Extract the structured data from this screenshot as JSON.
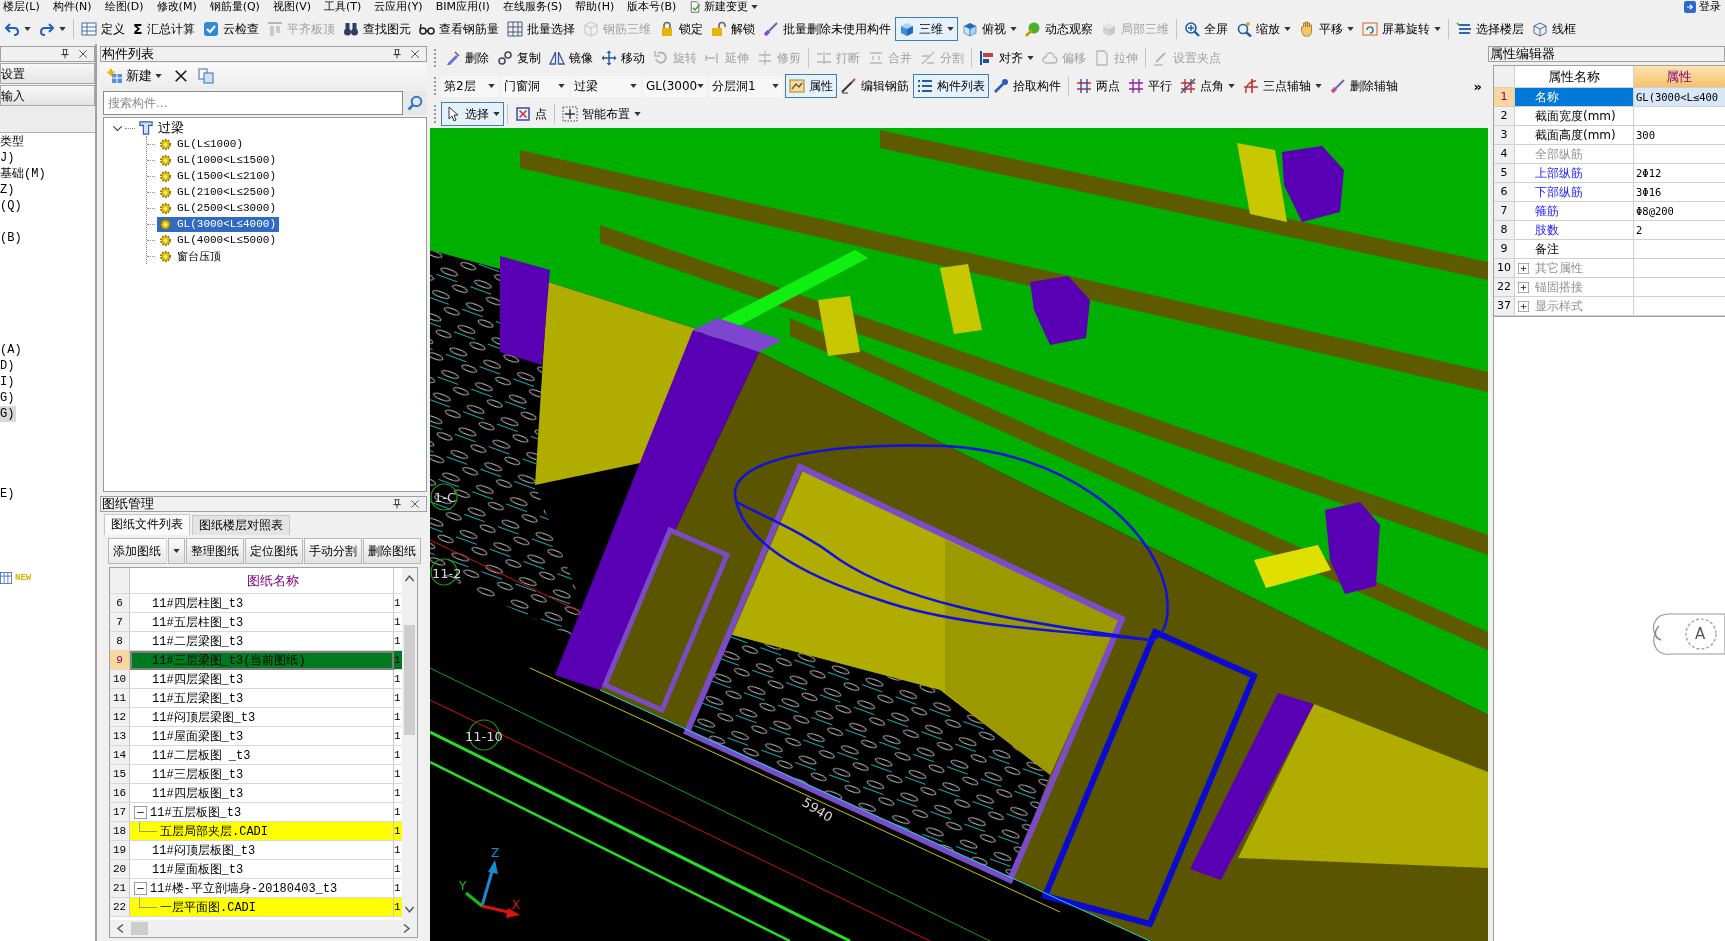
{
  "menu_bar": {
    "items": [
      "楼层(L)",
      "构件(N)",
      "绘图(D)",
      "修改(M)",
      "钢筋量(Q)",
      "视图(V)",
      "工具(T)",
      "云应用(Y)",
      "BIM应用(I)",
      "在线服务(S)",
      "帮助(H)",
      "版本号(B)"
    ],
    "change_menu": "新建变更",
    "login": "登录"
  },
  "main_toolbar": [
    {
      "kind": "button",
      "dropdown": true,
      "disabled": false,
      "pressed": false
    },
    {
      "kind": "button",
      "dropdown": true,
      "disabled": false,
      "pressed": false
    },
    {
      "kind": "separator"
    },
    {
      "kind": "button",
      "label": "定义",
      "dropdown": false,
      "disabled": false,
      "pressed": false
    },
    {
      "kind": "button",
      "symbol": "Σ",
      "label": "汇总计算",
      "dropdown": false,
      "disabled": false,
      "pressed": false
    },
    {
      "kind": "button",
      "label": "云检查",
      "dropdown": false,
      "disabled": false,
      "pressed": false
    },
    {
      "kind": "button",
      "label": "平齐板顶",
      "dropdown": false,
      "disabled": true,
      "pressed": false
    },
    {
      "kind": "button",
      "label": "查找图元",
      "dropdown": false,
      "disabled": false,
      "pressed": false
    },
    {
      "kind": "button",
      "label": "查看钢筋量",
      "dropdown": false,
      "disabled": false,
      "pressed": false
    },
    {
      "kind": "button",
      "label": "批量选择",
      "dropdown": false,
      "disabled": false,
      "pressed": false
    },
    {
      "kind": "button",
      "label": "钢筋三维",
      "dropdown": false,
      "disabled": true,
      "pressed": false
    },
    {
      "kind": "button",
      "label": "锁定",
      "dropdown": false,
      "disabled": false,
      "pressed": false
    },
    {
      "kind": "button",
      "label": "解锁",
      "dropdown": false,
      "disabled": false,
      "pressed": false
    },
    {
      "kind": "button",
      "label": "批量删除未使用构件",
      "dropdown": false,
      "disabled": false,
      "pressed": false
    },
    {
      "kind": "button",
      "label": "三维",
      "dropdown": true,
      "disabled": false,
      "pressed": true
    },
    {
      "kind": "button",
      "label": "俯视",
      "dropdown": true,
      "disabled": false,
      "pressed": false
    },
    {
      "kind": "button",
      "label": "动态观察",
      "dropdown": false,
      "disabled": false,
      "pressed": false
    },
    {
      "kind": "button",
      "label": "局部三维",
      "dropdown": false,
      "disabled": true,
      "pressed": false
    },
    {
      "kind": "separator"
    },
    {
      "kind": "button",
      "label": "全屏",
      "dropdown": false,
      "disabled": false,
      "pressed": false
    },
    {
      "kind": "button",
      "label": "缩放",
      "dropdown": true,
      "disabled": false,
      "pressed": false
    },
    {
      "kind": "button",
      "label": "平移",
      "dropdown": true,
      "disabled": false,
      "pressed": false
    },
    {
      "kind": "button",
      "label": "屏幕旋转",
      "dropdown": true,
      "disabled": false,
      "pressed": false
    },
    {
      "kind": "separator"
    },
    {
      "kind": "button",
      "label": "选择楼层",
      "dropdown": false,
      "disabled": false,
      "pressed": false
    },
    {
      "kind": "button",
      "label": "线框",
      "dropdown": false,
      "disabled": false,
      "pressed": false
    }
  ],
  "left_strip": {
    "tabs": [
      "设置",
      "输入"
    ],
    "items": [
      {
        "label": "类型",
        "selected": false
      },
      {
        "label": "J)",
        "selected": false
      },
      {
        "label": "基础(M)",
        "selected": false
      },
      {
        "label": "Z)",
        "selected": false
      },
      {
        "label": "(Q)",
        "selected": false
      },
      {
        "label": "(B)",
        "selected": false
      },
      {
        "label": "(A)",
        "selected": false
      },
      {
        "label": "D)",
        "selected": false
      },
      {
        "label": "I)",
        "selected": false
      },
      {
        "label": "G)",
        "selected": false
      },
      {
        "label": "G)",
        "selected": true
      },
      {
        "label": "E)",
        "selected": false
      }
    ],
    "new_badge": "NEW"
  },
  "component_list": {
    "title": "构件列表",
    "new_label": "新建",
    "search_placeholder": "搜索构件...",
    "tree": [
      {
        "label": "过梁",
        "expanded": true,
        "selected": false,
        "children": [
          {
            "label": "GL(L≤1000)",
            "selected": false
          },
          {
            "label": "GL(1000<L≤1500)",
            "selected": false
          },
          {
            "label": "GL(1500<L≤2100)",
            "selected": false
          },
          {
            "label": "GL(2100<L≤2500)",
            "selected": false
          },
          {
            "label": "GL(2500<L≤3000)",
            "selected": false
          },
          {
            "label": "GL(3000<L≤4000)",
            "selected": true
          },
          {
            "label": "GL(4000<L≤5000)",
            "selected": false
          },
          {
            "label": "窗台压顶",
            "selected": false
          }
        ]
      }
    ]
  },
  "drawing_manager": {
    "title": "图纸管理",
    "tabs": [
      {
        "label": "图纸文件列表",
        "selected": true
      },
      {
        "label": "图纸楼层对照表",
        "selected": false
      }
    ],
    "buttons": [
      {
        "label": "添加图纸",
        "dropdown": true
      },
      {
        "label": "整理图纸",
        "dropdown": false
      },
      {
        "label": "定位图纸",
        "dropdown": false
      },
      {
        "label": "手动分割",
        "dropdown": false
      },
      {
        "label": "删除图纸",
        "dropdown": false
      }
    ],
    "table": {
      "columns": [
        "图纸名称"
      ],
      "rows": [
        {
          "number": "6",
          "name": "11#四层柱图_t3",
          "column_3": "1",
          "selected": false
        },
        {
          "number": "7",
          "name": "11#五层柱图_t3",
          "column_3": "1",
          "selected": false
        },
        {
          "number": "8",
          "name": "11#二层梁图_t3",
          "column_3": "1",
          "selected": false
        },
        {
          "number": "9",
          "name": "11#三层梁图_t3(当前图纸)",
          "column_3": "1",
          "selected": true
        },
        {
          "number": "10",
          "name": "11#四层梁图_t3",
          "column_3": "1",
          "selected": false
        },
        {
          "number": "11",
          "name": "11#五层梁图_t3",
          "column_3": "1",
          "selected": false
        },
        {
          "number": "12",
          "name": "11#闷顶层梁图_t3",
          "column_3": "1",
          "selected": false
        },
        {
          "number": "13",
          "name": "11#屋面梁图_t3",
          "column_3": "1",
          "selected": false
        },
        {
          "number": "14",
          "name": "11#二层板图 _t3",
          "column_3": "1",
          "selected": false
        },
        {
          "number": "15",
          "name": "11#三层板图_t3",
          "column_3": "1",
          "selected": false
        },
        {
          "number": "16",
          "name": "11#四层板图_t3",
          "column_3": "1",
          "selected": false
        },
        {
          "number": "17",
          "name": "11#五层板图_t3",
          "column_3": "1",
          "selected": false,
          "expanded": true,
          "children": [
            {
              "number": "18",
              "name": "五层局部夹层.CADI",
              "column_3": "1",
              "selected": false
            }
          ]
        },
        {
          "number": "19",
          "name": "11#闷顶层板图_t3",
          "column_3": "1",
          "selected": false
        },
        {
          "number": "20",
          "name": "11#屋面板图_t3",
          "column_3": "1",
          "selected": false
        },
        {
          "number": "21",
          "name": "11#楼-平立剖墙身-20180403_t3",
          "column_3": "1",
          "selected": false,
          "expanded": true,
          "children": [
            {
              "number": "22",
              "name": "一层平面图.CADI",
              "column_3": "1",
              "selected": false
            }
          ]
        }
      ]
    }
  },
  "edit_toolbar": [
    {
      "kind": "button",
      "label": "删除",
      "dropdown": false,
      "disabled": false,
      "pressed": false
    },
    {
      "kind": "button",
      "label": "复制",
      "dropdown": false,
      "disabled": false,
      "pressed": false
    },
    {
      "kind": "button",
      "label": "镜像",
      "dropdown": false,
      "disabled": false,
      "pressed": false
    },
    {
      "kind": "button",
      "label": "移动",
      "dropdown": false,
      "disabled": false,
      "pressed": false
    },
    {
      "kind": "button",
      "label": "旋转",
      "dropdown": false,
      "disabled": true,
      "pressed": false
    },
    {
      "kind": "button",
      "label": "延伸",
      "dropdown": false,
      "disabled": true,
      "pressed": false
    },
    {
      "kind": "button",
      "label": "修剪",
      "dropdown": false,
      "disabled": true,
      "pressed": false
    },
    {
      "kind": "separator"
    },
    {
      "kind": "button",
      "label": "打断",
      "dropdown": false,
      "disabled": true,
      "pressed": false
    },
    {
      "kind": "button",
      "label": "合并",
      "dropdown": false,
      "disabled": true,
      "pressed": false
    },
    {
      "kind": "button",
      "label": "分割",
      "dropdown": false,
      "disabled": true,
      "pressed": false
    },
    {
      "kind": "separator"
    },
    {
      "kind": "button",
      "label": "对齐",
      "dropdown": true,
      "disabled": false,
      "pressed": false
    },
    {
      "kind": "button",
      "label": "偏移",
      "dropdown": false,
      "disabled": true,
      "pressed": false
    },
    {
      "kind": "button",
      "label": "拉伸",
      "dropdown": false,
      "disabled": true,
      "pressed": false
    },
    {
      "kind": "separator"
    },
    {
      "kind": "button",
      "label": "设置夹点",
      "dropdown": false,
      "disabled": true,
      "pressed": false
    }
  ],
  "property_toolbar": {
    "items": [
      {
        "kind": "select",
        "value": "第2层"
      },
      {
        "kind": "select",
        "value": "门窗洞"
      },
      {
        "kind": "select",
        "value": "过梁"
      },
      {
        "kind": "select",
        "value": "GL(3000"
      },
      {
        "kind": "select",
        "value": "分层洞1"
      },
      {
        "kind": "button",
        "label": "属性",
        "dropdown": false,
        "disabled": false,
        "pressed": true
      },
      {
        "kind": "button",
        "label": "编辑钢筋",
        "dropdown": false,
        "disabled": false,
        "pressed": false
      },
      {
        "kind": "button",
        "label": "构件列表",
        "dropdown": false,
        "disabled": false,
        "pressed": true
      },
      {
        "kind": "button",
        "label": "拾取构件",
        "dropdown": false,
        "disabled": false,
        "pressed": false
      },
      {
        "kind": "separator"
      },
      {
        "kind": "button",
        "label": "两点",
        "dropdown": false,
        "disabled": false,
        "pressed": false
      },
      {
        "kind": "button",
        "label": "平行",
        "dropdown": false,
        "disabled": false,
        "pressed": false
      },
      {
        "kind": "button",
        "label": "点角",
        "dropdown": true,
        "disabled": false,
        "pressed": false
      },
      {
        "kind": "button",
        "label": "三点辅轴",
        "dropdown": true,
        "disabled": false,
        "pressed": false
      },
      {
        "kind": "button",
        "label": "删除辅轴",
        "dropdown": false,
        "disabled": false,
        "pressed": false
      }
    ],
    "overflow": "»"
  },
  "draw_toolbar": [
    {
      "kind": "button",
      "label": "选择",
      "dropdown": true,
      "disabled": false,
      "pressed": true
    },
    {
      "kind": "separator"
    },
    {
      "kind": "button",
      "label": "点",
      "dropdown": false,
      "disabled": false,
      "pressed": false
    },
    {
      "kind": "separator"
    },
    {
      "kind": "button",
      "label": "智能布置",
      "dropdown": true,
      "disabled": false,
      "pressed": false
    }
  ],
  "viewport": {
    "grid_labels": [
      "1-C",
      "11-2",
      "11-10"
    ],
    "dimension": "5940",
    "axis_letters": [
      "Z",
      "Y",
      "X"
    ]
  },
  "property_editor": {
    "title": "属性编辑器",
    "columns": [
      "属性名称",
      "属性"
    ],
    "rows": [
      {
        "number": "1",
        "name": "名称",
        "value": "GL(3000<L≤400",
        "kind": "property",
        "selected": true,
        "public": false,
        "disabled": false
      },
      {
        "number": "2",
        "name": "截面宽度(mm)",
        "kind": "property",
        "selected": false,
        "public": false,
        "disabled": false
      },
      {
        "number": "3",
        "name": "截面高度(mm)",
        "value": "300",
        "kind": "property",
        "selected": false,
        "public": false,
        "disabled": false
      },
      {
        "number": "4",
        "name": "全部纵筋",
        "kind": "property",
        "selected": false,
        "public": false,
        "disabled": true
      },
      {
        "number": "5",
        "name": "上部纵筋",
        "value": "2Φ12",
        "kind": "property",
        "selected": false,
        "public": true,
        "disabled": false
      },
      {
        "number": "6",
        "name": "下部纵筋",
        "value": "3Φ16",
        "kind": "property",
        "selected": false,
        "public": true,
        "disabled": false
      },
      {
        "number": "7",
        "name": "箍筋",
        "value": "Φ8@200",
        "kind": "property",
        "selected": false,
        "public": true,
        "disabled": false
      },
      {
        "number": "8",
        "name": "肢数",
        "value": "2",
        "kind": "property",
        "selected": false,
        "public": true,
        "disabled": false
      },
      {
        "number": "9",
        "name": "备注",
        "kind": "property",
        "selected": false,
        "public": false,
        "disabled": false
      },
      {
        "number": "10",
        "name": "其它属性",
        "kind": "group",
        "expanded": false,
        "selected": false,
        "public": false,
        "disabled": true
      },
      {
        "number": "22",
        "name": "锚固搭接",
        "kind": "group",
        "expanded": false,
        "selected": false,
        "public": false,
        "disabled": true
      },
      {
        "number": "37",
        "name": "显示样式",
        "kind": "group",
        "expanded": false,
        "selected": false,
        "public": false,
        "disabled": true
      }
    ]
  },
  "assistant": {
    "label": "A"
  }
}
